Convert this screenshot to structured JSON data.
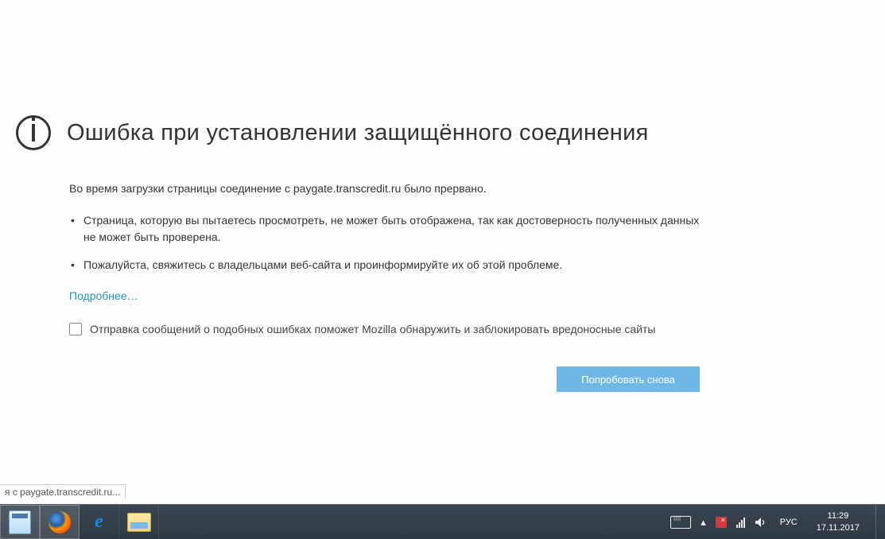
{
  "error": {
    "title": "Ошибка при установлении защищённого соединения",
    "intro": "Во время загрузки страницы соединение с paygate.transcredit.ru было прервано.",
    "bullets": [
      "Страница, которую вы пытаетесь просмотреть, не может быть отображена, так как достоверность полученных данных не может быть проверена.",
      "Пожалуйста, свяжитесь с владельцами веб-сайта и проинформируйте их об этой проблеме."
    ],
    "learn_more": "Подробнее…",
    "report_label": "Отправка сообщений о подобных ошибках поможет Mozilla обнаружить и заблокировать вредоносные сайты",
    "try_again": "Попробовать снова"
  },
  "status_tooltip": "я с paygate.transcredit.ru...",
  "taskbar": {
    "lang": "РУС",
    "time": "11:29",
    "date": "17.11.2017"
  }
}
